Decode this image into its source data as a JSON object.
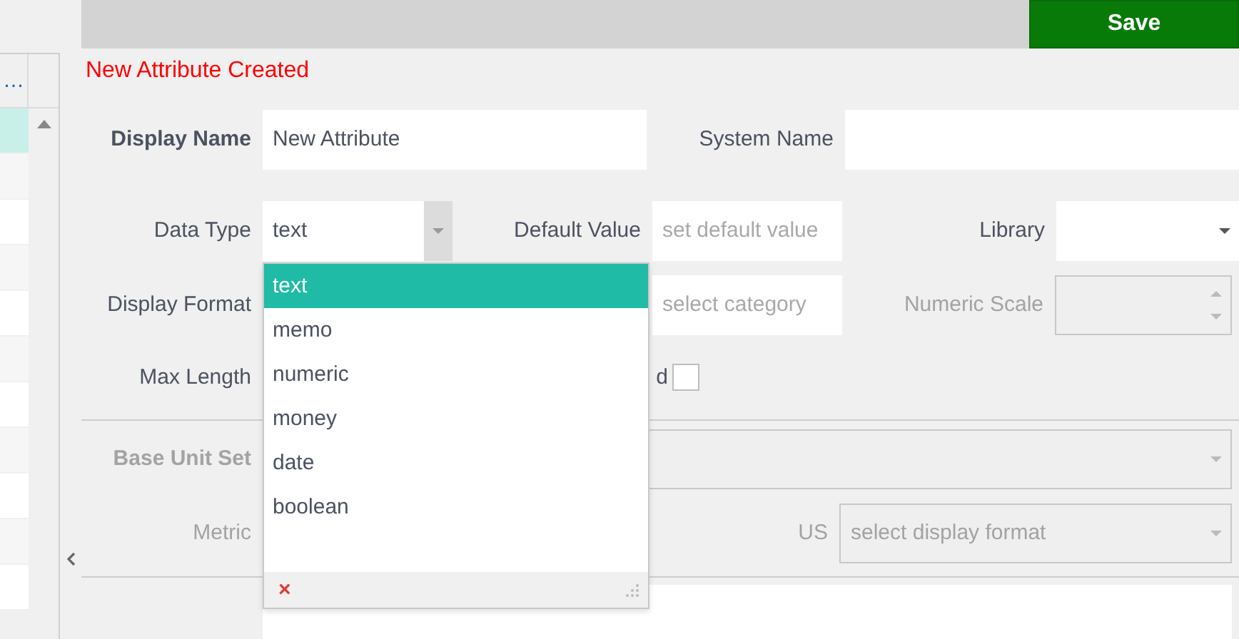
{
  "sidebar": {
    "header": "…",
    "rows": [
      {
        "selected": true
      },
      {
        "selected": false
      },
      {
        "selected": false
      },
      {
        "selected": false
      },
      {
        "selected": false
      },
      {
        "selected": false
      },
      {
        "selected": false
      },
      {
        "selected": false
      },
      {
        "selected": false
      },
      {
        "selected": false
      },
      {
        "selected": false
      }
    ]
  },
  "top_bar": {
    "save_button": "Save"
  },
  "message": "New Attribute Created",
  "form": {
    "display_name": {
      "label": "Display Name",
      "value": "New Attribute"
    },
    "system_name": {
      "label": "System Name"
    },
    "data_type": {
      "label": "Data Type",
      "value": "text"
    },
    "default_value": {
      "label": "Default Value",
      "placeholder": "set default value"
    },
    "library": {
      "label": "Library"
    },
    "display_format": {
      "label": "Display Format"
    },
    "category": {
      "placeholder": "select category"
    },
    "numeric_scale": {
      "label": "Numeric Scale",
      "disabled": true
    },
    "max_length": {
      "label": "Max Length"
    },
    "flag": {
      "label": "d",
      "checked": false
    },
    "base_unit_set": {
      "label": "Base Unit Set",
      "disabled": true
    },
    "metric": {
      "label": "Metric",
      "disabled": true
    },
    "us": {
      "label": "US",
      "placeholder": "select display format",
      "disabled": true
    }
  },
  "dropdown": {
    "options": [
      {
        "label": "text",
        "selected": true
      },
      {
        "label": "memo",
        "selected": false
      },
      {
        "label": "numeric",
        "selected": false
      },
      {
        "label": "money",
        "selected": false
      },
      {
        "label": "date",
        "selected": false
      },
      {
        "label": "boolean",
        "selected": false
      }
    ],
    "clear": "×"
  }
}
